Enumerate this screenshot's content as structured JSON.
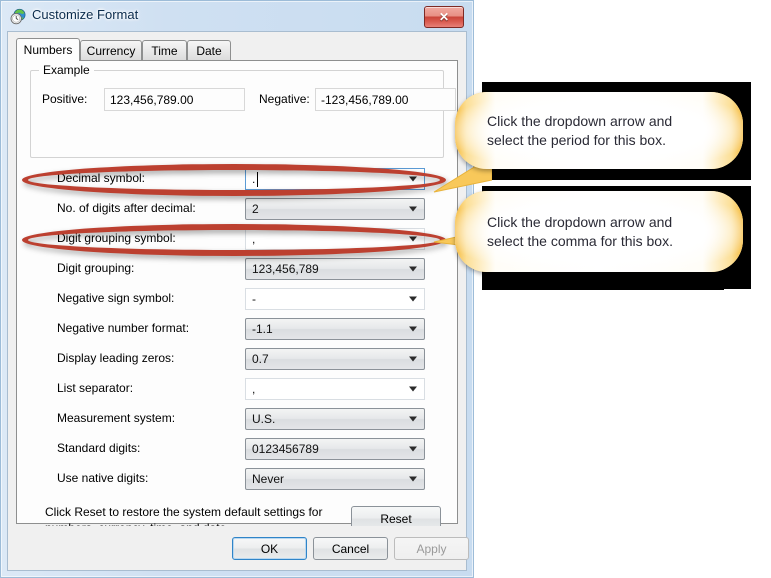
{
  "window": {
    "title": "Customize Format",
    "icon": "region-globe-clock-icon",
    "close_label": "✕"
  },
  "tabs": [
    {
      "label": "Numbers",
      "active": true
    },
    {
      "label": "Currency",
      "active": false
    },
    {
      "label": "Time",
      "active": false
    },
    {
      "label": "Date",
      "active": false
    }
  ],
  "example": {
    "legend": "Example",
    "positive_label": "Positive:",
    "positive_value": "123,456,789.00",
    "negative_label": "Negative:",
    "negative_value": "-123,456,789.00"
  },
  "settings": [
    {
      "label": "Decimal symbol:",
      "value": ".",
      "style": "focus"
    },
    {
      "label": "No. of digits after decimal:",
      "value": "2",
      "style": "gray"
    },
    {
      "label": "Digit grouping symbol:",
      "value": ",",
      "style": "white"
    },
    {
      "label": "Digit grouping:",
      "value": "123,456,789",
      "style": "gray"
    },
    {
      "label": "Negative sign symbol:",
      "value": "-",
      "style": "white"
    },
    {
      "label": "Negative number format:",
      "value": "-1.1",
      "style": "gray"
    },
    {
      "label": "Display leading zeros:",
      "value": "0.7",
      "style": "gray"
    },
    {
      "label": "List separator:",
      "value": ",",
      "style": "white"
    },
    {
      "label": "Measurement system:",
      "value": "U.S.",
      "style": "gray"
    },
    {
      "label": "Standard digits:",
      "value": "0123456789",
      "style": "gray"
    },
    {
      "label": "Use native digits:",
      "value": "Never",
      "style": "gray"
    }
  ],
  "reset": {
    "description_line1": "Click Reset to restore the system default settings for",
    "description_line2": "numbers, currency, time, and date.",
    "button_label": "Reset"
  },
  "buttons": {
    "ok": "OK",
    "cancel": "Cancel",
    "apply": "Apply"
  },
  "callouts": [
    {
      "line1": "Click the dropdown arrow and",
      "line2": "select the period for this box."
    },
    {
      "line1": "Click the dropdown arrow and",
      "line2": "select the comma for this box."
    }
  ],
  "colors": {
    "annotation_red": "#bc4030",
    "callout_yellow": "#f5bb3f",
    "title_text": "#0a2b4c"
  }
}
